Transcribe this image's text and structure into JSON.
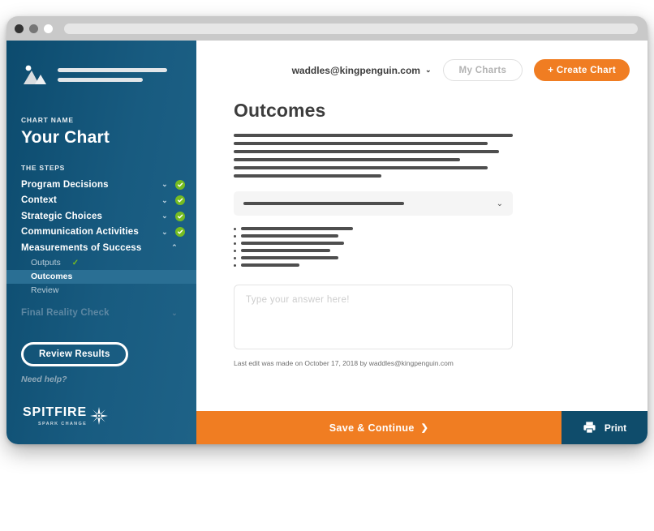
{
  "browser": {
    "traffic_lights": [
      "close-dot",
      "minimize-dot",
      "maximize-dot"
    ],
    "url_value": ""
  },
  "sidebar": {
    "brand_icon": "image-placeholder-icon",
    "chart_name_label": "CHART NAME",
    "chart_title": "Your Chart",
    "steps_label": "THE STEPS",
    "steps": [
      {
        "label": "Program Decisions",
        "chevron": "chevron-down",
        "complete": true,
        "dim": false
      },
      {
        "label": "Context",
        "chevron": "chevron-down",
        "complete": true,
        "dim": false
      },
      {
        "label": "Strategic Choices",
        "chevron": "chevron-down",
        "complete": true,
        "dim": false
      },
      {
        "label": "Communication Activities",
        "chevron": "chevron-down",
        "complete": true,
        "dim": false
      },
      {
        "label": "Measurements of Success",
        "chevron": "chevron-up",
        "complete": false,
        "dim": false
      }
    ],
    "sub_steps": [
      {
        "label": "Outputs",
        "checked": true,
        "active": false
      },
      {
        "label": "Outcomes",
        "checked": false,
        "active": true
      },
      {
        "label": "Review",
        "checked": false,
        "active": false
      }
    ],
    "final_step": {
      "label": "Final Reality Check",
      "chevron": "chevron-down"
    },
    "review_button": "Review Results",
    "need_help": "Need help?",
    "logo": {
      "name": "SPITFIRE",
      "tagline": "SPARK CHANGE",
      "icon": "starburst-icon"
    },
    "colors": {
      "bg_start": "#0c4b6e",
      "bg_end": "#1e6287",
      "active_row": "#2a6f94",
      "check_green": "#76bc21"
    }
  },
  "header": {
    "account_email": "waddles@kingpenguin.com",
    "account_chevron": "chevron-down",
    "my_charts_label": "My Charts",
    "create_chart_label": "+ Create Chart",
    "accent_orange": "#f07d22"
  },
  "main": {
    "page_title": "Outcomes",
    "paragraph_bar_widths": [
      "100%",
      "91%",
      "95%",
      "81%",
      "91%",
      "53%"
    ],
    "select": {
      "bar_width": "62%",
      "chevron": "chevron-down"
    },
    "bullet_bar_widths": [
      "40%",
      "35%",
      "37%",
      "32%",
      "35%",
      "21%"
    ],
    "answer_placeholder": "Type your answer here!",
    "last_edit": "Last edit was made on October 17, 2018 by waddles@kingpenguin.com"
  },
  "footer": {
    "save_label": "Save & Continue",
    "save_arrow": "❯",
    "print_label": "Print",
    "print_icon": "printer-icon",
    "save_bg": "#f07d22",
    "print_bg": "#0f4c6b"
  }
}
